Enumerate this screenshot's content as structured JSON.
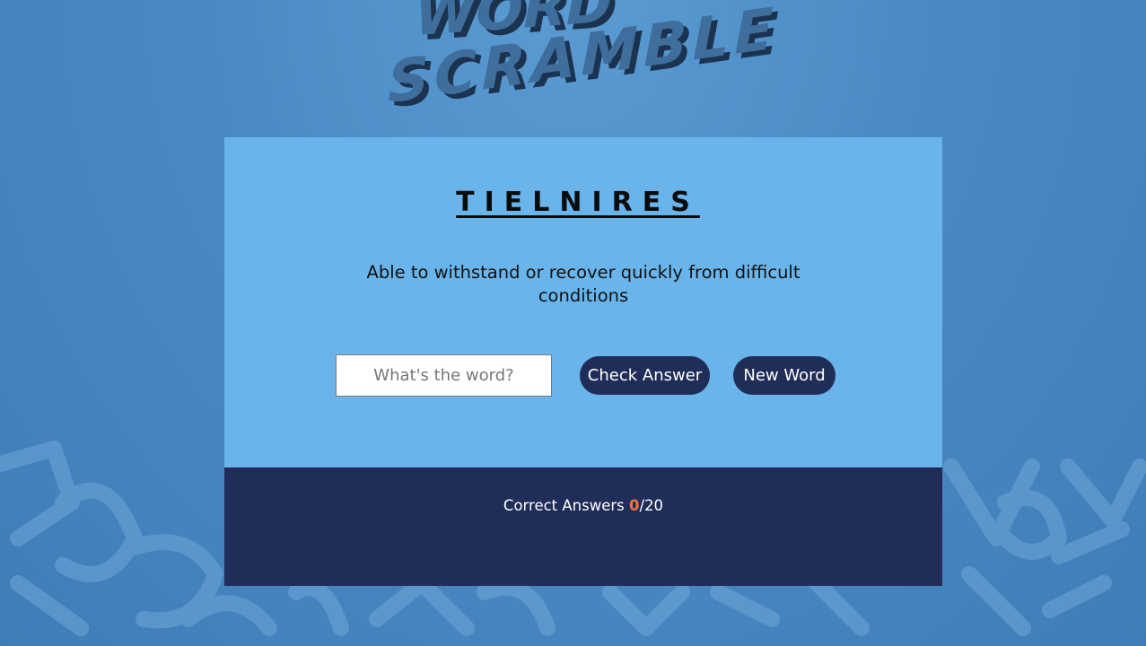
{
  "logo": {
    "line1": "WORD",
    "line2": "SCRAMBLE",
    "colors": {
      "face": "#3f6e9c",
      "side": "#1c3350"
    }
  },
  "game": {
    "scrambled_word": "TIELNIRES",
    "hint": "Able to withstand or recover quickly from difficult conditions",
    "input": {
      "placeholder": "What's the word?",
      "value": ""
    },
    "check_button": "Check Answer",
    "new_word_button": "New Word"
  },
  "footer": {
    "label": "Correct Answers",
    "correct": "0",
    "separator": "/",
    "total": "20"
  },
  "colors": {
    "background": "#4a8ac4",
    "card": "#69b5eb",
    "footer": "#202d58",
    "button": "#202d58",
    "score_accent": "#f2703a"
  }
}
